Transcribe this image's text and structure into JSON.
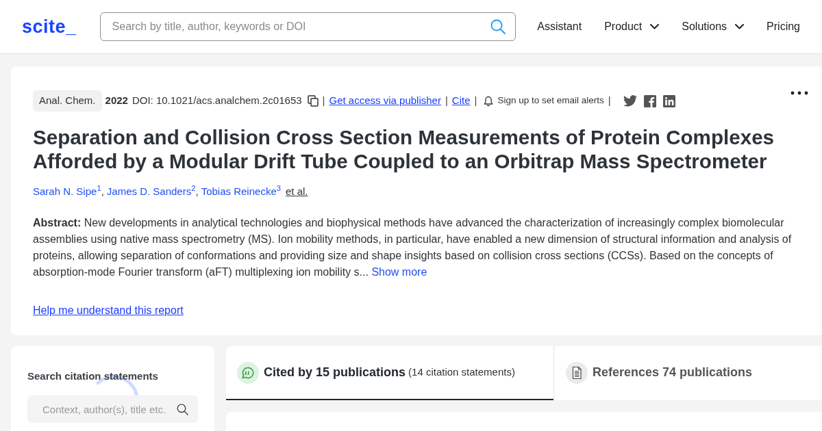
{
  "header": {
    "logo": "scite_",
    "search": {
      "placeholder": "Search by title, author, keywords or DOI"
    },
    "nav": [
      {
        "label": "Assistant",
        "dropdown": false
      },
      {
        "label": "Product",
        "dropdown": true
      },
      {
        "label": "Solutions",
        "dropdown": true
      },
      {
        "label": "Pricing",
        "dropdown": false
      }
    ]
  },
  "paper": {
    "meta": [
      {
        "kind": "badge",
        "text": "Anal. Chem."
      },
      {
        "kind": "year",
        "text": "2022"
      },
      {
        "kind": "doi",
        "text": "DOI: 10.1021/acs.analchem.2c01653"
      },
      {
        "kind": "separator",
        "text": "|"
      },
      {
        "kind": "link",
        "text": "Get access via publisher"
      },
      {
        "kind": "separator",
        "text": "|"
      },
      {
        "kind": "link",
        "text": "Cite"
      },
      {
        "kind": "separator",
        "text": "|"
      },
      {
        "kind": "alert",
        "text": "Sign up to set email alerts"
      },
      {
        "kind": "separator",
        "text": "|"
      }
    ],
    "title": "Separation and Collision Cross Section Measurements of Protein Complexes Afforded by a Modular Drift Tube Coupled to an Orbitrap Mass Spectrometer",
    "authors": [
      {
        "name": "Sarah N. Sipe$^{1}$",
        "separator": ","
      },
      {
        "name": "James D. Sanders$^{2}$",
        "separator": ","
      },
      {
        "name": "Tobias Reinecke$^{3}$"
      }
    ],
    "et_al": "et al.",
    "abstract": {
      "text": "**Abstract:** New developments in analytical technologies and biophysical methods have advanced the characterization of increasingly complex biomolecular assemblies using native mass spectrometry (MS). Ion mobility methods, in particular, have enabled a new dimension of structural information and analysis of proteins, allowing separation of conformations and providing size and shape insights based on collision cross sections (CCSs). Based on the concepts of absorption-mode Fourier transform (aFT) multiplexing ion mobility s...",
      "more": "Show more"
    },
    "help_link": "Help me understand this report"
  },
  "sidebar": {
    "title": "Search citation statements",
    "search": {
      "placeholder": "Context, author(s), title etc."
    }
  },
  "tabs": [
    {
      "kind": "citing",
      "label": "Cited by 15 publications",
      "detail": "(14 citation statements)",
      "selected": true
    },
    {
      "kind": "references",
      "label": "References 74 publications",
      "selected": false
    }
  ]
}
